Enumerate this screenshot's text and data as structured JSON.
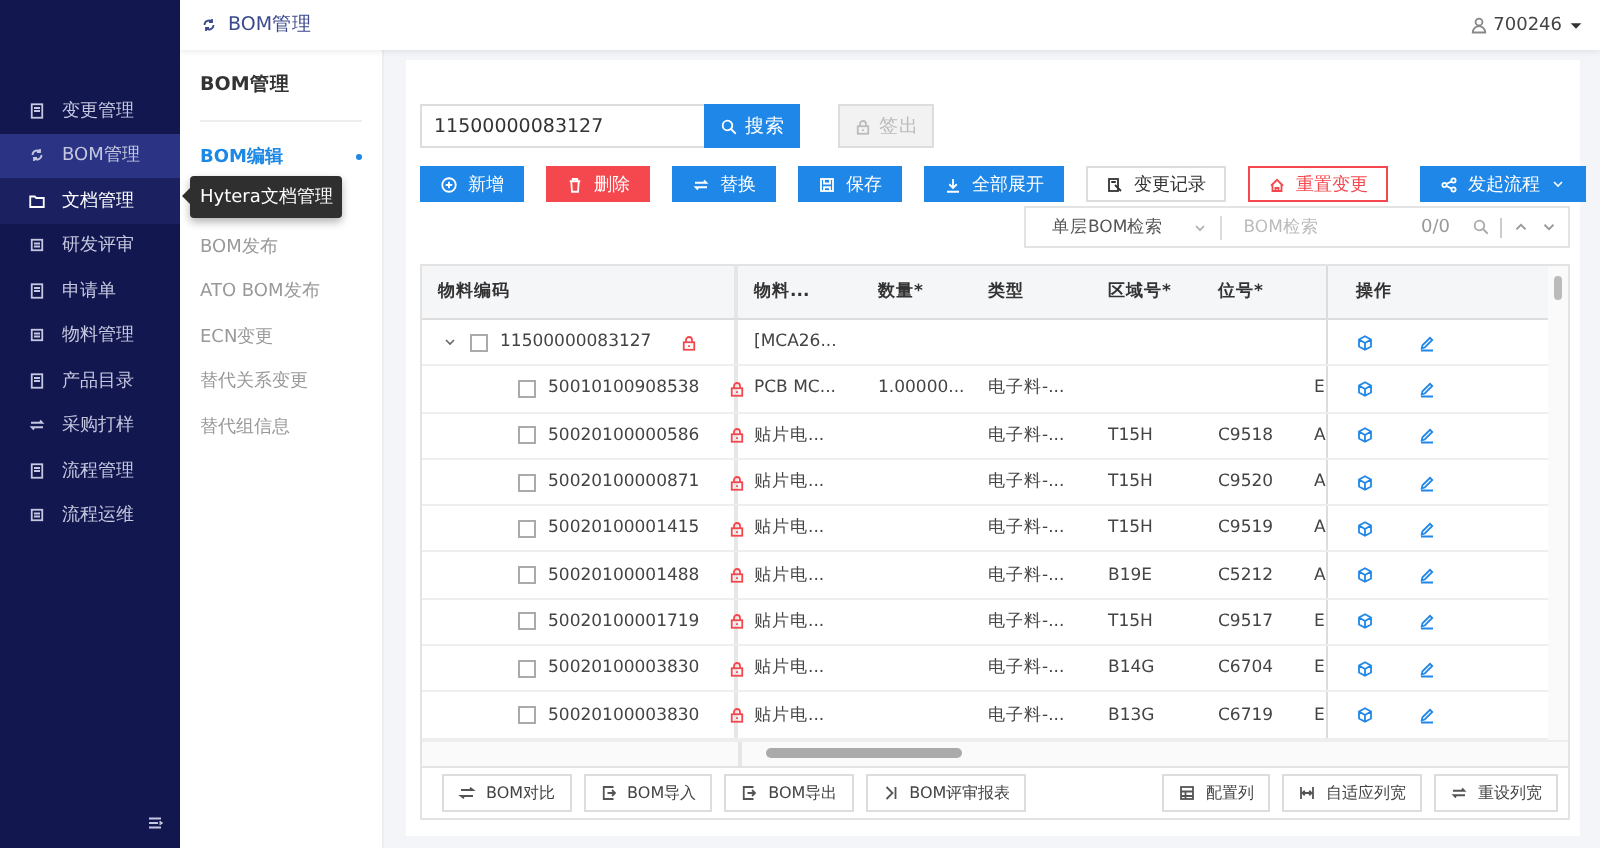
{
  "sidebar": {
    "items": [
      {
        "label": "变更管理",
        "selected": false,
        "hovered": false
      },
      {
        "label": "BOM管理",
        "selected": true,
        "hovered": false
      },
      {
        "label": "文档管理",
        "selected": false,
        "hovered": true
      },
      {
        "label": "研发评审",
        "selected": false,
        "hovered": false
      },
      {
        "label": "申请单",
        "selected": false,
        "hovered": false
      },
      {
        "label": "物料管理",
        "selected": false,
        "hovered": false
      },
      {
        "label": "产品目录",
        "selected": false,
        "hovered": false
      },
      {
        "label": "采购打样",
        "selected": false,
        "hovered": false
      },
      {
        "label": "流程管理",
        "selected": false,
        "hovered": false
      },
      {
        "label": "流程运维",
        "selected": false,
        "hovered": false
      }
    ]
  },
  "tooltip": {
    "text": "Hytera文档管理"
  },
  "topbar": {
    "breadcrumb": "BOM管理",
    "user": "700246"
  },
  "submenu": {
    "title": "BOM管理",
    "items": [
      {
        "label": "BOM编辑",
        "selected": true
      },
      {
        "label": "BOM发布",
        "selected": false
      },
      {
        "label": "ATO BOM发布",
        "selected": false
      },
      {
        "label": "ECN变更",
        "selected": false
      },
      {
        "label": "替代关系变更",
        "selected": false
      },
      {
        "label": "替代组信息",
        "selected": false
      }
    ]
  },
  "search": {
    "value": "11500000083127",
    "button": "搜索",
    "checkout": {
      "label": "签出",
      "disabled": true
    }
  },
  "actions": [
    {
      "label": "新增",
      "kind": "primary"
    },
    {
      "label": "删除",
      "kind": "danger"
    },
    {
      "label": "替换",
      "kind": "primary"
    },
    {
      "label": "保存",
      "kind": "primary"
    },
    {
      "label": "全部展开",
      "kind": "primary"
    },
    {
      "label": "变更记录",
      "kind": "default"
    },
    {
      "label": "重置变更",
      "kind": "danger-outline"
    },
    {
      "label": "发起流程",
      "kind": "dropdown"
    }
  ],
  "finder": {
    "scope": "单层BOM检索",
    "placeholder": "BOM检索",
    "count": "0/0"
  },
  "table": {
    "columns": [
      "物料编码",
      "物料...",
      "数量*",
      "类型",
      "区域号*",
      "位号*",
      "操作"
    ],
    "rows": [
      {
        "code": "11500000083127",
        "checked": false,
        "locked": true,
        "expanded": true,
        "material": "[MCA26...",
        "children": [
          {
            "code": "50010100908538",
            "checked": false,
            "locked": true,
            "material": "PCB MC...",
            "quantity": "1.00000...",
            "type": "电子料-...",
            "column_7": "E"
          },
          {
            "code": "50020100000586",
            "checked": false,
            "locked": true,
            "material": "贴片电...",
            "type": "电子料-...",
            "area": "T15H",
            "position": "C9518",
            "column_7": "A"
          },
          {
            "code": "50020100000871",
            "checked": false,
            "locked": true,
            "material": "贴片电...",
            "type": "电子料-...",
            "area": "T15H",
            "position": "C9520",
            "column_7": "A"
          },
          {
            "code": "50020100001415",
            "checked": false,
            "locked": true,
            "material": "贴片电...",
            "type": "电子料-...",
            "area": "T15H",
            "position": "C9519",
            "column_7": "A"
          },
          {
            "code": "50020100001488",
            "checked": false,
            "locked": true,
            "material": "贴片电...",
            "type": "电子料-...",
            "area": "B19E",
            "position": "C5212",
            "column_7": "A"
          },
          {
            "code": "50020100001719",
            "checked": false,
            "locked": true,
            "material": "贴片电...",
            "type": "电子料-...",
            "area": "T15H",
            "position": "C9517",
            "column_7": "E"
          },
          {
            "code": "50020100003830",
            "checked": false,
            "locked": true,
            "material": "贴片电...",
            "type": "电子料-...",
            "area": "B14G",
            "position": "C6704",
            "column_7": "E"
          },
          {
            "code": "50020100003830",
            "checked": false,
            "locked": true,
            "material": "贴片电...",
            "type": "电子料-...",
            "area": "B13G",
            "position": "C6719",
            "column_7": "E"
          }
        ]
      }
    ]
  },
  "footer": {
    "left": [
      "BOM对比",
      "BOM导入",
      "BOM导出",
      "BOM评审报表"
    ],
    "right": [
      "配置列",
      "自适应列宽",
      "重设列宽"
    ]
  }
}
